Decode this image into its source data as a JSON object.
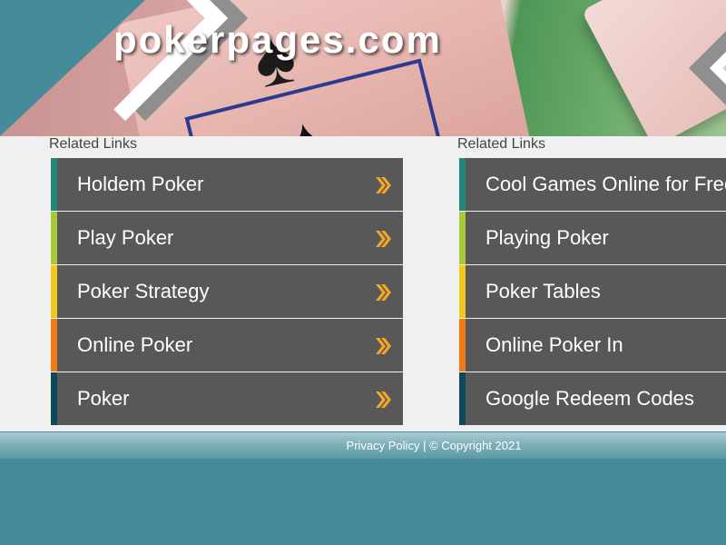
{
  "header": {
    "site_title": "pokerpages.com"
  },
  "columns": [
    {
      "title": "Related Links",
      "links": [
        {
          "label": "Holdem Poker",
          "accent": "#23877a"
        },
        {
          "label": "Play Poker",
          "accent": "#a8c93a"
        },
        {
          "label": "Poker Strategy",
          "accent": "#f0c81e"
        },
        {
          "label": "Online Poker",
          "accent": "#f07a16"
        },
        {
          "label": "Poker",
          "accent": "#0e4a5a"
        }
      ]
    },
    {
      "title": "Related Links",
      "links": [
        {
          "label": "Cool Games Online for Free",
          "accent": "#23877a"
        },
        {
          "label": "Playing Poker",
          "accent": "#a8c93a"
        },
        {
          "label": "Poker Tables",
          "accent": "#f0c81e"
        },
        {
          "label": "Online Poker In",
          "accent": "#f07a16"
        },
        {
          "label": "Google Redeem Codes",
          "accent": "#0e4a5a"
        }
      ]
    }
  ],
  "icons": {
    "link_arrow": "double-chevron-right-icon"
  },
  "colors": {
    "page_background": "#458b99",
    "content_background": "#f0f0f0",
    "link_background": "#585858",
    "arrow": "#f5a623"
  },
  "footer": {
    "privacy_label": "Privacy Policy",
    "separator": "|",
    "copyright": "© Copyright 2021"
  }
}
